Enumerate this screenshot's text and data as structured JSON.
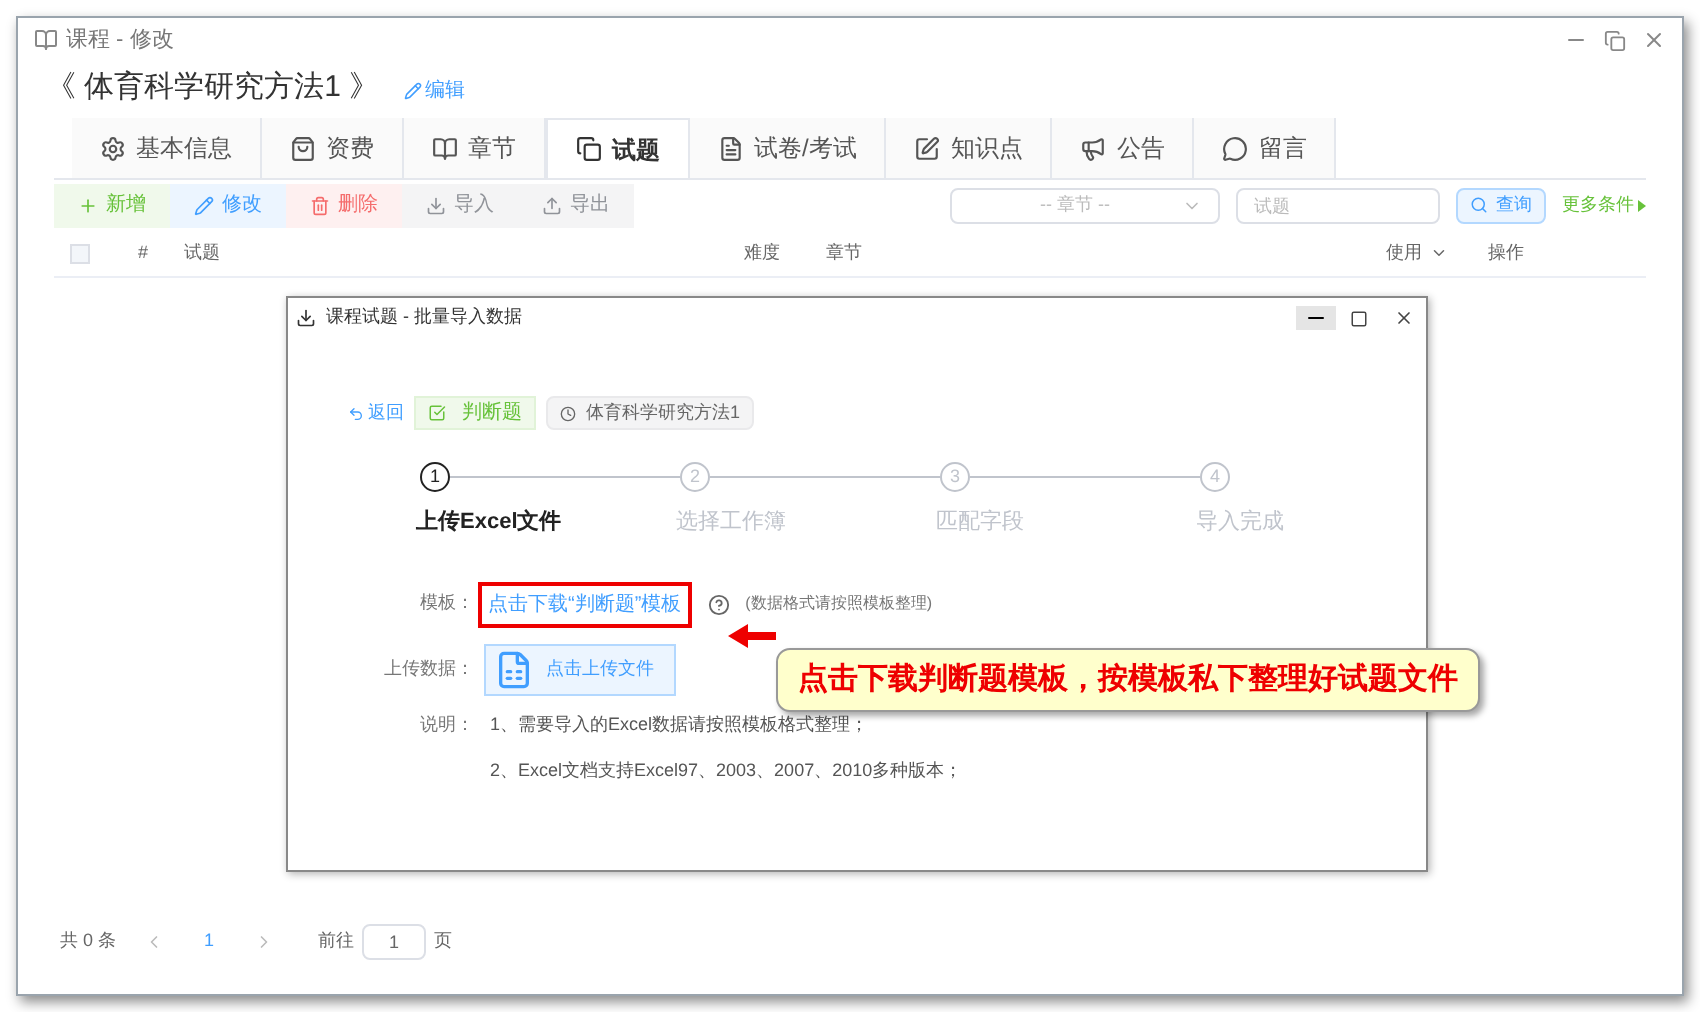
{
  "window": {
    "title": "课程 - 修改"
  },
  "course": {
    "title": "《 体育科学研究方法1 》",
    "edit_link": "编辑"
  },
  "tabs": [
    {
      "label": "基本信息",
      "selected": false
    },
    {
      "label": "资费",
      "selected": false
    },
    {
      "label": "章节",
      "selected": false
    },
    {
      "label": "试题",
      "selected": true
    },
    {
      "label": "试卷/考试",
      "selected": false
    },
    {
      "label": "知识点",
      "selected": false
    },
    {
      "label": "公告",
      "selected": false
    },
    {
      "label": "留言",
      "selected": false
    }
  ],
  "toolbar": [
    {
      "label": "新增",
      "kind": "add"
    },
    {
      "label": "修改",
      "kind": "edit"
    },
    {
      "label": "删除",
      "kind": "delete"
    },
    {
      "label": "导入",
      "kind": "import"
    },
    {
      "label": "导出",
      "kind": "export"
    }
  ],
  "filters": {
    "chapter_placeholder": "-- 章节 --",
    "question_placeholder": "试题",
    "search_button": "查询",
    "more_link": "更多条件"
  },
  "table": {
    "select_all_checked": false,
    "columns": [
      "#",
      "试题",
      "难度",
      "章节",
      "使用",
      "操作"
    ]
  },
  "pagination": {
    "total": "共 0 条",
    "current": "1",
    "goto_label": "前往",
    "goto_value": "1",
    "page_suffix": "页"
  },
  "dialog": {
    "title": "课程试题 - 批量导入数据",
    "back": "返回",
    "type_tag": "判断题",
    "course_tag": "体育科学研究方法1",
    "steps": [
      {
        "number": "1",
        "label": "上传Excel文件",
        "selected": true
      },
      {
        "number": "2",
        "label": "选择工作簿",
        "selected": false
      },
      {
        "number": "3",
        "label": "匹配字段",
        "selected": false
      },
      {
        "number": "4",
        "label": "导入完成",
        "selected": false
      }
    ],
    "template_label": "模板：",
    "template_link": "点击下载“判断题”模板",
    "template_hint": "(数据格式请按照模板整理)",
    "upload_label": "上传数据：",
    "upload_button": "点击上传文件",
    "notes_label": "说明：",
    "notes": [
      "1、需要导入的Excel数据请按照模板格式整理；",
      "2、Excel文档支持Excel97、2003、2007、2010多种版本；"
    ]
  },
  "annotation": {
    "text": "点击下载判断题模板，按模板私下整理好试题文件"
  }
}
